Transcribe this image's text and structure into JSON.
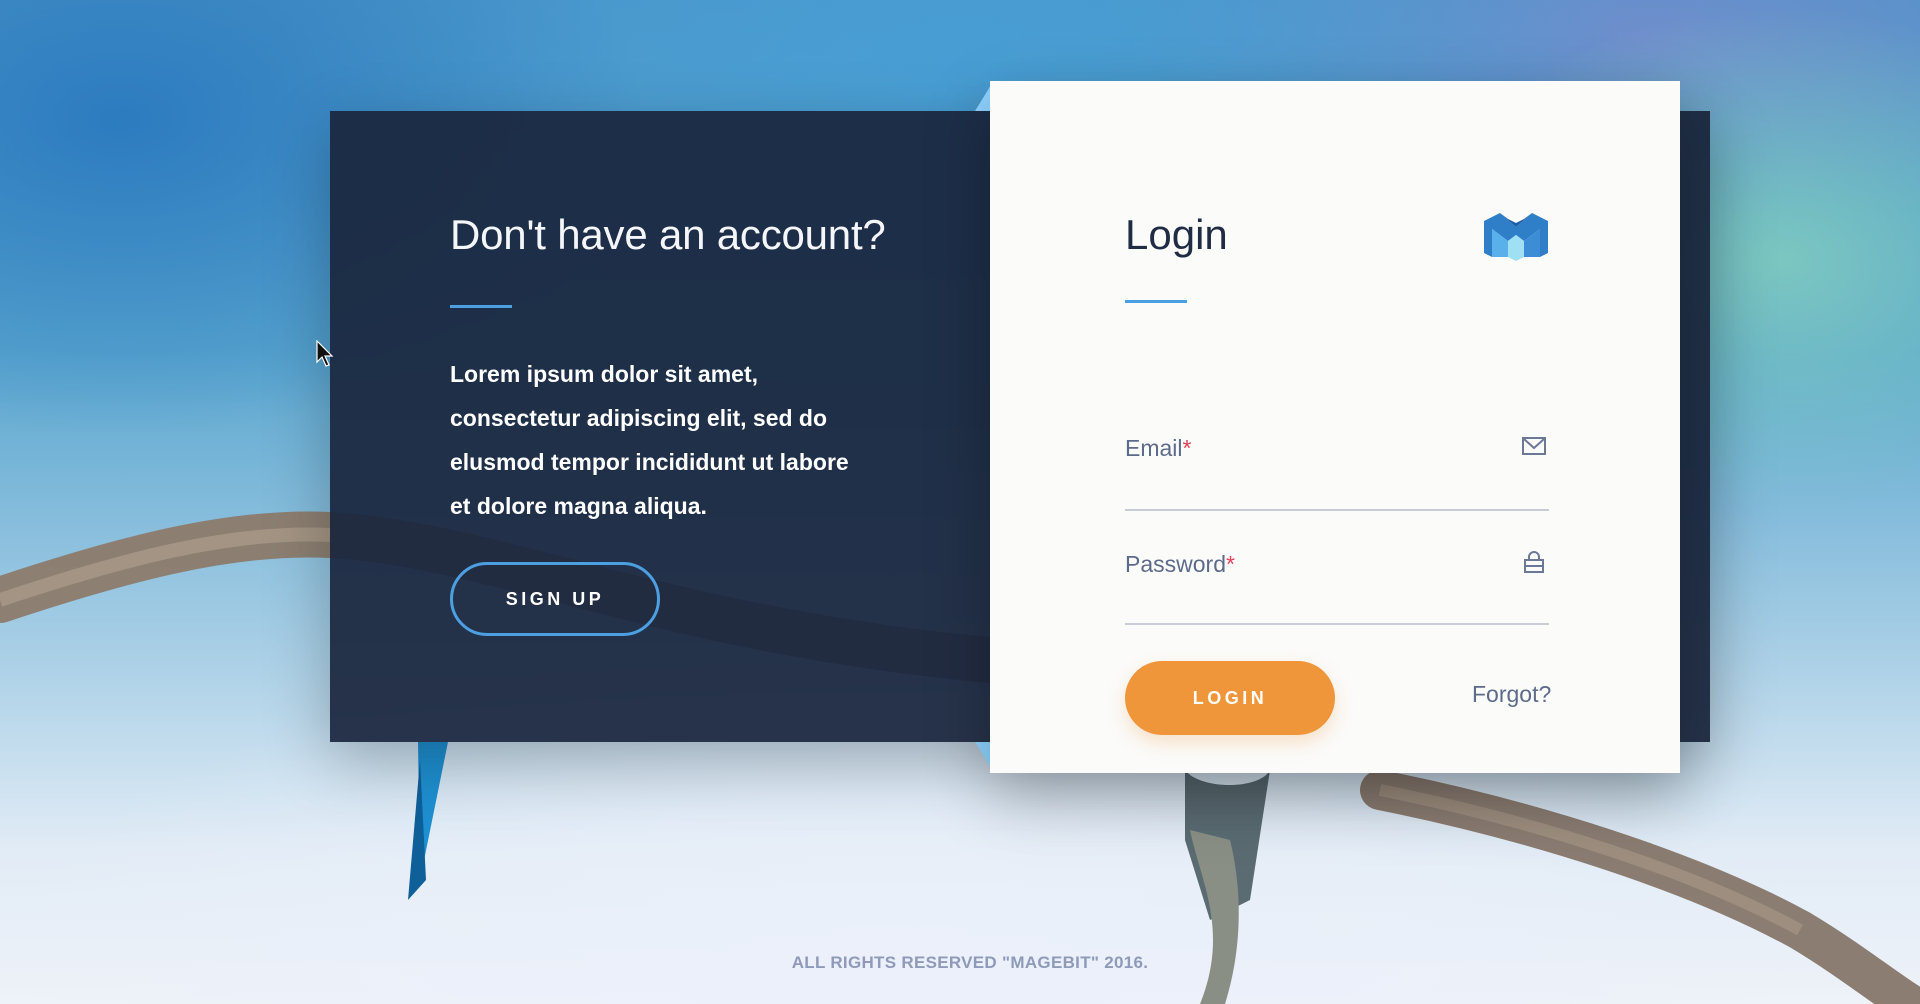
{
  "signup": {
    "heading": "Don't have an account?",
    "text": "Lorem ipsum dolor sit amet, consectetur adipiscing elit, sed do elusmod tempor incididunt ut labore et dolore magna aliqua.",
    "button_label": "SIGN UP"
  },
  "login": {
    "title": "Login",
    "email": {
      "label": "Email",
      "required_mark": "*",
      "value": "",
      "icon": "envelope-icon"
    },
    "password": {
      "label": "Password",
      "required_mark": "*",
      "value": "",
      "icon": "lock-icon"
    },
    "button_label": "LOGIN",
    "forgot_label": "Forgot?",
    "logo_icon": "magebit-logo-icon"
  },
  "footer": {
    "text": "ALL RIGHTS RESERVED \"MAGEBIT\" 2016."
  },
  "colors": {
    "dark_panel": "#1a263d",
    "accent_blue": "#4c9fe0",
    "login_button": "#f0963a",
    "required": "#e2405a",
    "muted_text": "#5d6b8a"
  }
}
